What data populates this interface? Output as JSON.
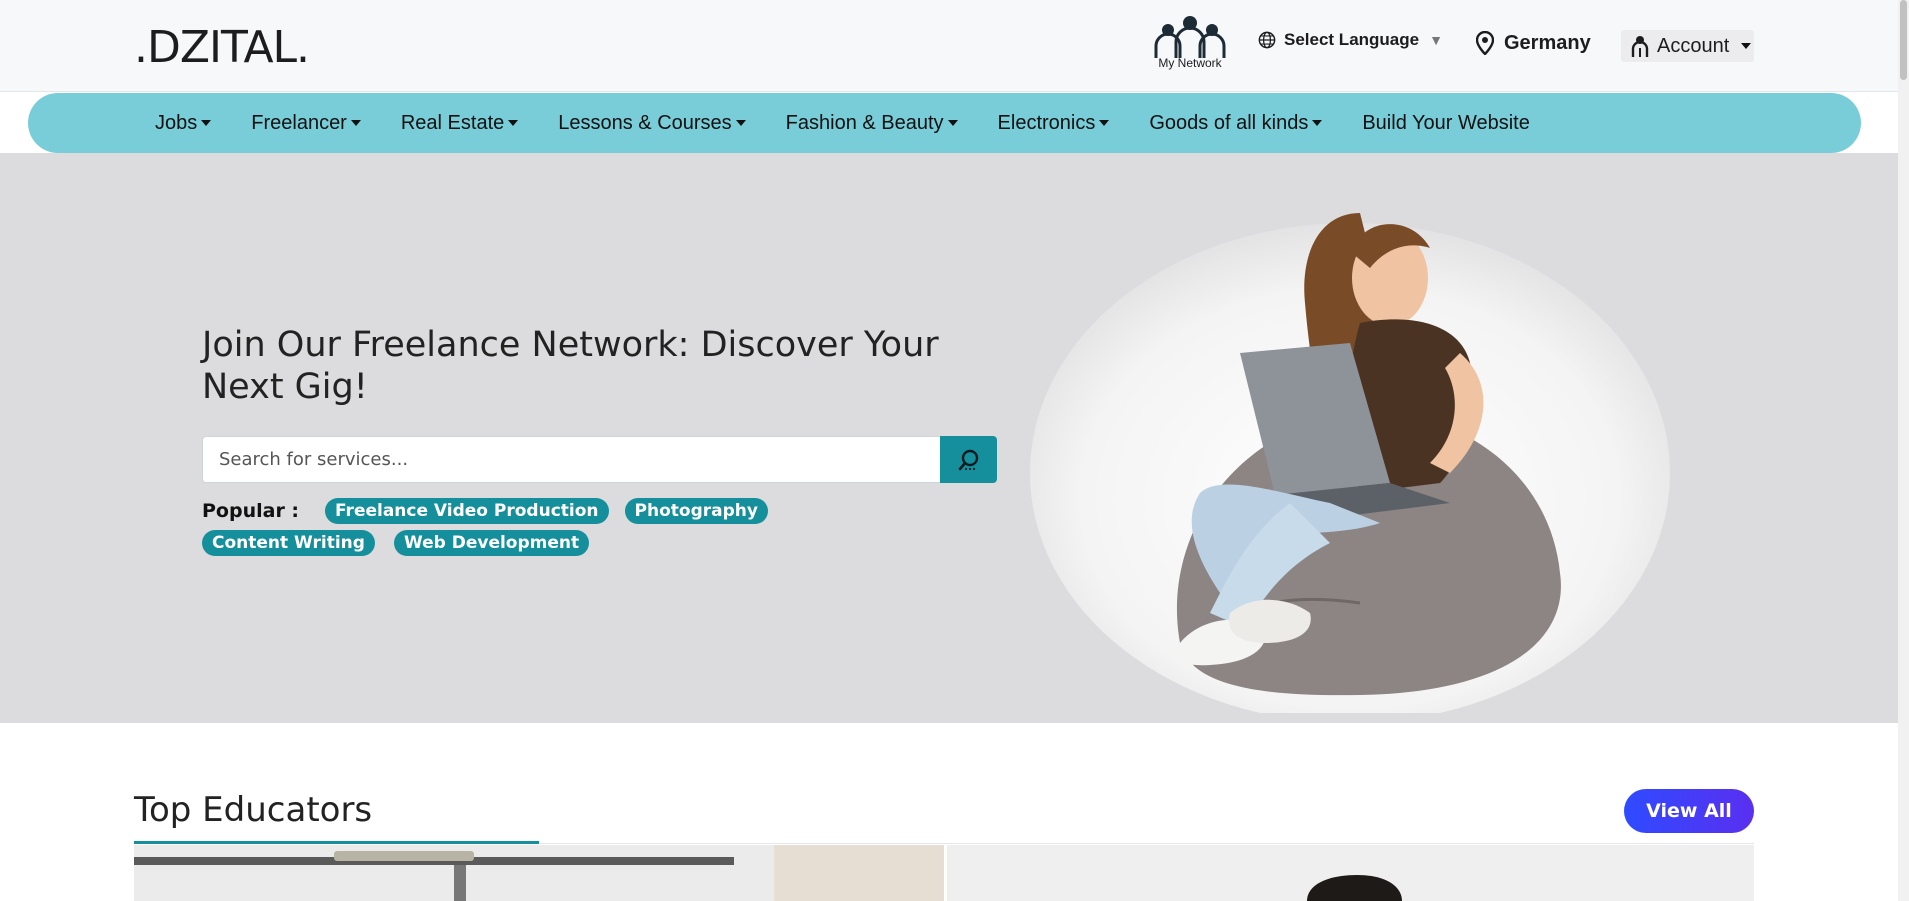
{
  "brand": {
    "logo_text": ".DZITAL."
  },
  "header": {
    "network_label": "My Network",
    "language_label": "Select Language",
    "location_label": "Germany",
    "account_label": "Account"
  },
  "nav": {
    "items": [
      {
        "label": "Jobs",
        "dropdown": true
      },
      {
        "label": "Freelancer",
        "dropdown": true
      },
      {
        "label": "Real Estate",
        "dropdown": true
      },
      {
        "label": "Lessons & Courses",
        "dropdown": true
      },
      {
        "label": "Fashion & Beauty",
        "dropdown": true
      },
      {
        "label": "Electronics",
        "dropdown": true
      },
      {
        "label": "Goods of all kinds",
        "dropdown": true
      },
      {
        "label": "Build Your Website",
        "dropdown": false
      }
    ]
  },
  "hero": {
    "title": "Join Our Freelance Network: Discover Your Next Gig!",
    "search_placeholder": "Search for services...",
    "popular_label": "Popular :",
    "popular_tags": [
      "Freelance Video Production",
      "Photography",
      "Content Writing",
      "Web Development"
    ]
  },
  "section": {
    "title": "Top Educators",
    "view_all_label": "View All"
  },
  "colors": {
    "nav_bg": "#79cdd8",
    "accent": "#158f9b",
    "hero_bg": "#dcdcde",
    "view_all_gradient": [
      "#2f4bff",
      "#5a2ff0"
    ]
  },
  "icons": [
    "people-network-icon",
    "globe-icon",
    "map-pin-icon",
    "user-icon",
    "search-icon",
    "caret-down-icon"
  ]
}
